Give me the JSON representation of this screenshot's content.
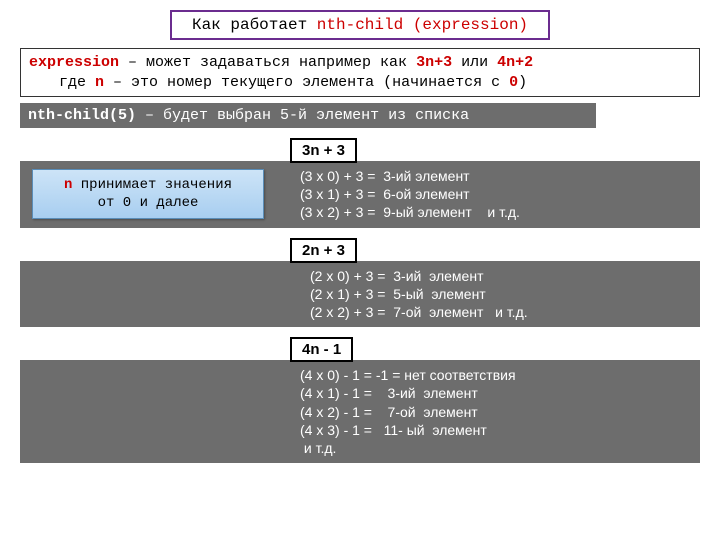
{
  "title": {
    "part1": "Как работает  ",
    "part2": "nth-child (expression)"
  },
  "expr_box": {
    "t1": "expression",
    "t2": " – может задаваться например как  ",
    "t3": "3n+3",
    "t4": " или  ",
    "t5": "4n+2",
    "t6": "где ",
    "t7": "n",
    "t8": " – это номер текущего элемента (начинается с  ",
    "t9": "0",
    "t10": ")"
  },
  "bar1": {
    "a": "nth-child(5)",
    "b": " – будет выбран 5-й элемент из списка"
  },
  "bluebox": {
    "n": "n",
    "l1": " принимает значения",
    "l2": "от 0 и далее"
  },
  "sec1": {
    "label": "3n + 3",
    "r0": "(3 х 0) + 3 =  3-ий элемент",
    "r1": "(3 х 1) + 3 =  6-ой элемент",
    "r2": "(3 х 2) + 3 =  9-ый элемент    и т.д."
  },
  "sec2": {
    "label": "2n + 3",
    "r0": "(2 х 0) + 3 =  3-ий  элемент",
    "r1": "(2 х 1) + 3 =  5-ый  элемент",
    "r2": "(2 х 2) + 3 =  7-ой  элемент   и т.д."
  },
  "sec3": {
    "label": "4n - 1",
    "r0": "(4 х 0) - 1 = -1 = нет соответствия",
    "r1": "(4 х 1) - 1 =    3-ий  элемент",
    "r2": "(4 х 2) - 1 =    7-ой  элемент",
    "r3": "(4 х 3) - 1 =   11- ый  элемент",
    "r4": " и т.д."
  }
}
